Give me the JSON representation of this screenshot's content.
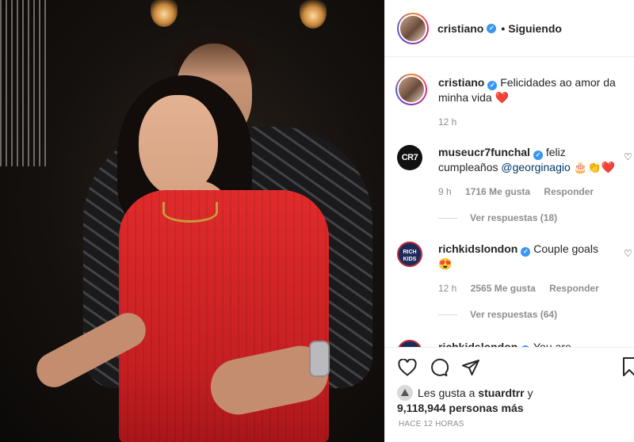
{
  "post": {
    "photo_alt": "post-photo",
    "author": "cristiano",
    "follow_status": "Siguiendo",
    "separator": "•"
  },
  "caption": {
    "username": "cristiano",
    "text": "Felicidades ao amor da minha vida ❤️",
    "time": "12 h"
  },
  "comments": [
    {
      "username": "museucr7funchal",
      "avatar_text": "CR7",
      "text_before": "feliz cumpleaños",
      "mention": "@georginagio",
      "text_after": "🎂👏❤️",
      "time": "9 h",
      "likes": "1716 Me gusta",
      "reply": "Responder",
      "view_replies": "Ver respuestas (18)"
    },
    {
      "username": "richkidslondon",
      "avatar_text": "RICH KIDS",
      "text_before": "Couple goals",
      "emoji": "😍",
      "time": "12 h",
      "likes": "2565 Me gusta",
      "reply": "Responder",
      "view_replies": "Ver respuestas (64)"
    },
    {
      "username": "richkidslondon",
      "text_before": "You are"
    }
  ],
  "likes_summary": {
    "prefix": "Les gusta a",
    "user": "stuardtrr",
    "connector": "y",
    "count": "9,118,944 personas más"
  },
  "posted_ago": "HACE 12 HORAS",
  "icons": {
    "like": "heart-icon",
    "comment": "comment-icon",
    "share": "share-icon",
    "save": "bookmark-icon",
    "comment_like": "heart-icon"
  },
  "colors": {
    "verified": "#3897f0",
    "mention": "#00376b",
    "meta": "#8e8e8e"
  }
}
